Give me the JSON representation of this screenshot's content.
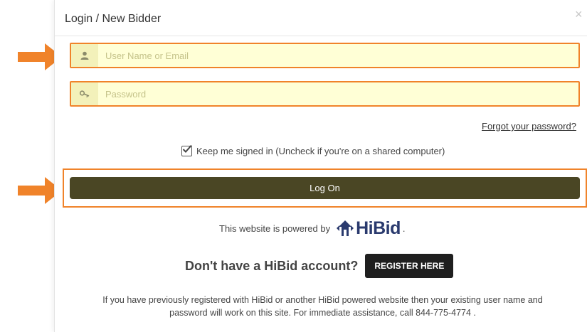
{
  "modal": {
    "title": "Login / New Bidder",
    "close_glyph": "×"
  },
  "form": {
    "username_placeholder": "User Name or Email",
    "username_value": "",
    "username_icon": "user-icon",
    "password_placeholder": "Password",
    "password_value": "",
    "password_icon": "key-icon",
    "forgot_label": "Forgot your password?",
    "remember_label": "Keep me signed in (Uncheck if you're on a shared computer)",
    "remember_checked": true,
    "login_label": "Log On"
  },
  "powered": {
    "text": "This website is powered by",
    "logo_text": "HiBid",
    "suffix": "."
  },
  "register": {
    "question": "Don't have a HiBid account?",
    "button_label": "REGISTER HERE"
  },
  "info": {
    "line1": "If you have previously registered with HiBid or another HiBid powered website then your existing user name and",
    "line2": "password will work on this site. For immediate assistance, call 844-775-4774 ."
  },
  "colors": {
    "highlight": "#f0832a",
    "login_button": "#4a4624",
    "input_bg": "#ffffd6",
    "brand": "#2a3a6e"
  }
}
